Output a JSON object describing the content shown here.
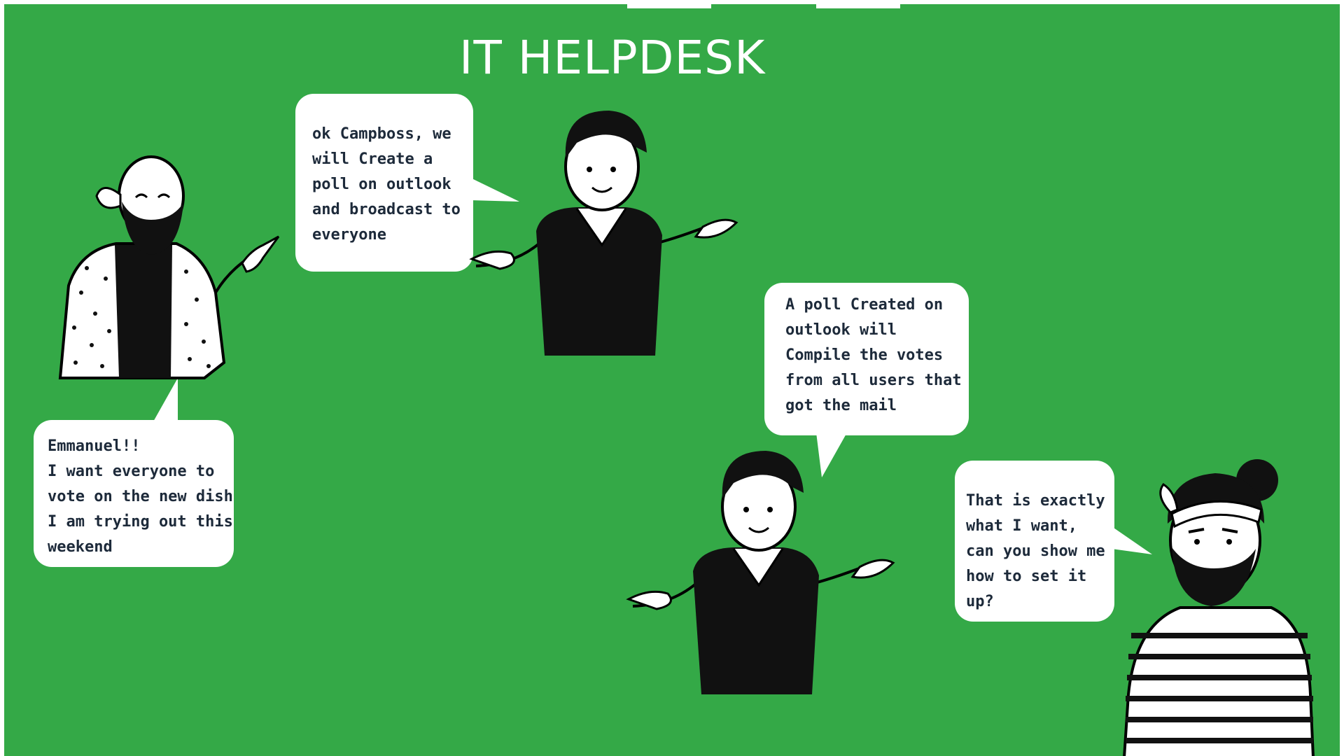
{
  "page": {
    "title": "IT HELPDESK",
    "background_color": "#34a947",
    "bubble_color": "#ffffff",
    "text_color": "#1d2a3a"
  },
  "conversation": [
    {
      "speaker": "campboss-1",
      "text": "Emmanuel!!\nI want everyone to vote on the new dish I am trying out this weekend"
    },
    {
      "speaker": "helpdesk-1",
      "text": "ok Campboss, we will Create a poll on outlook and broadcast to everyone"
    },
    {
      "speaker": "helpdesk-2",
      "text": "A poll Created on outlook will Compile the votes from all users that got the mail"
    },
    {
      "speaker": "campboss-2",
      "text": "That is exactly what I want, can you show me how to set it up?"
    }
  ],
  "illustrations": [
    {
      "name": "bearded-bald-man",
      "icon": "person-pointing-icon"
    },
    {
      "name": "helpdesk-agent",
      "icon": "person-shrugging-icon"
    },
    {
      "name": "helpdesk-agent",
      "icon": "person-shrugging-icon"
    },
    {
      "name": "bearded-man-bandana",
      "icon": "person-striped-shirt-icon"
    }
  ]
}
